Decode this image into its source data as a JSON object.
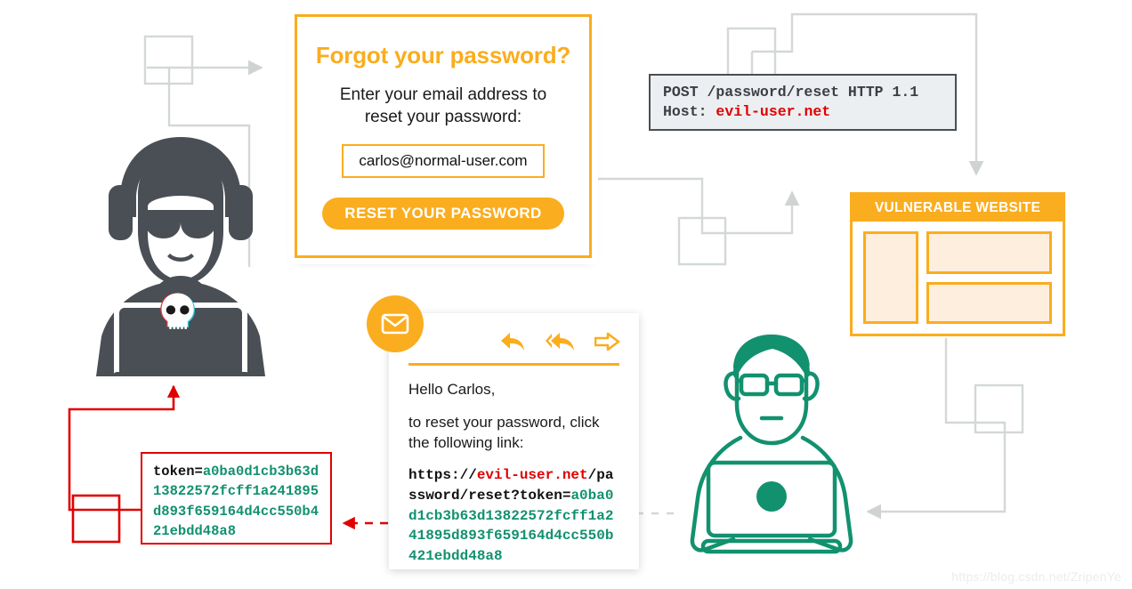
{
  "diagram": {
    "title": "Password reset poisoning attack flow",
    "colors": {
      "orange": "#FAAD1E",
      "orange_fill": "#fdeedd",
      "red": "#e00000",
      "green": "#12916f",
      "dark_gray": "#4a4f55",
      "wire_gray": "#d3d8d6",
      "http_bg": "#eceff1"
    }
  },
  "reset_card": {
    "title": "Forgot your password?",
    "subtitle": "Enter your email address to reset your password:",
    "email_value": "carlos@normal-user.com",
    "email_placeholder": "carlos@normal-user.com",
    "button_label": "RESET YOUR PASSWORD"
  },
  "http_request": {
    "request_line": "POST /password/reset HTTP 1.1",
    "host_label": "Host:",
    "host_value": "evil-user.net"
  },
  "vulnerable_website": {
    "header": "VULNERABLE WEBSITE",
    "blocks": [
      "sidebar-block",
      "content-block-1",
      "content-block-2"
    ]
  },
  "email_card": {
    "icons": [
      "reply-icon",
      "reply-all-icon",
      "forward-icon"
    ],
    "badge_icon": "envelope-icon",
    "greeting": "Hello Carlos,",
    "body": "to reset your password, click the following link:",
    "link": {
      "scheme": "https://",
      "host": "evil-user.net",
      "path": "/password/reset?token=",
      "token": "a0ba0d1cb3b63d13822572fcff1a241895d893f659164d4cc550b421ebdd48a8"
    }
  },
  "token_box": {
    "key": "token=",
    "value": "a0ba0d1cb3b63d13822572fcff1a241895d893f659164d4cc550b421ebdd48a8"
  },
  "actors": {
    "attacker": {
      "name": "attacker-hacker-figure",
      "laptop_sticker": "skull-icon"
    },
    "victim": {
      "name": "victim-user-figure"
    }
  },
  "watermark": {
    "text": "https://blog.csdn.net/ZripenYe"
  }
}
